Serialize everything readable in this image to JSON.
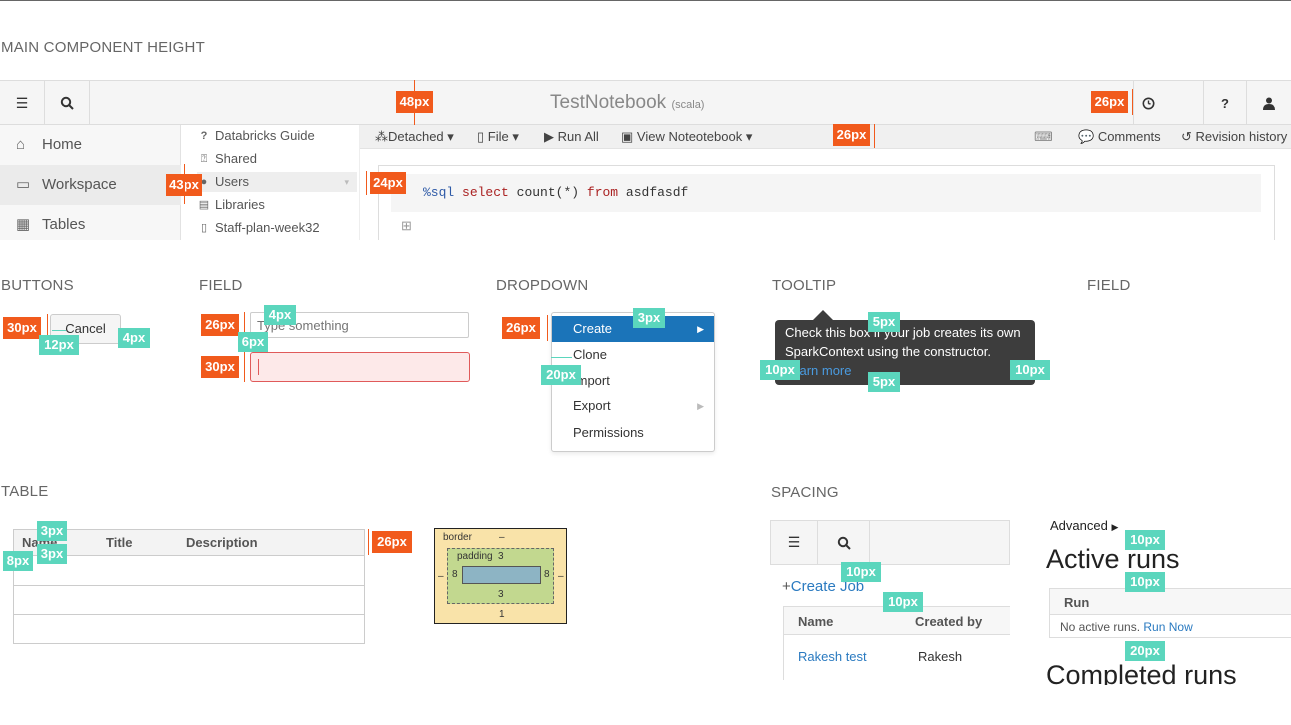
{
  "sections": {
    "main": "MAIN COMPONENT HEIGHT",
    "buttons": "BUTTONS",
    "field": "FIELD",
    "dropdown": "DROPDOWN",
    "tooltip": "TOOLTIP",
    "field2": "FIELD",
    "table": "TABLE",
    "spacing": "SPACING"
  },
  "notebook": {
    "title": "TestNotebook",
    "lang": "(scala)",
    "help": "?",
    "sidebar": [
      {
        "icon": "home-icon",
        "glyph": "⌂",
        "label": "Home"
      },
      {
        "icon": "folder-icon",
        "glyph": "▭",
        "label": "Workspace"
      },
      {
        "icon": "table-icon",
        "glyph": "▦",
        "label": "Tables"
      }
    ],
    "folder": [
      {
        "icon": "question-icon",
        "glyph": "?",
        "label": "Databricks Guide"
      },
      {
        "icon": "shared-icon",
        "glyph": "⍰",
        "label": "Shared"
      },
      {
        "icon": "user-icon",
        "glyph": "●",
        "label": "Users"
      },
      {
        "icon": "library-icon",
        "glyph": "▤",
        "label": "Libraries"
      },
      {
        "icon": "file-icon",
        "glyph": "▯",
        "label": "Staff-plan-week32"
      }
    ],
    "toolbar": {
      "detached": "Detached",
      "file": "File",
      "runall": "Run All",
      "view": "View Noteotebook",
      "comments": "Comments",
      "revision": "Revision history"
    },
    "code_kw1": "%sql",
    "code_kw2": "select",
    "code_mid": "count(*)",
    "code_kw3": "from",
    "code_end": "asdfasdf",
    "add_cell": "⊞"
  },
  "buttons": {
    "cancel": "Cancel"
  },
  "field": {
    "placeholder": "Type something"
  },
  "dropdown": {
    "items": [
      "Create",
      "Clone",
      "Import",
      "Export",
      "Permissions"
    ]
  },
  "tooltip": {
    "line1": "Check this box if your job creates its own",
    "line2": "SparkContext using the constructor.",
    "link": "Learn more"
  },
  "table": {
    "headers": [
      "Name",
      "Title",
      "Description"
    ]
  },
  "boxmodel": {
    "border": "border",
    "border_dash": "–",
    "padding": "padding",
    "padding_top": "3",
    "left_border": "–",
    "left_pad": "8",
    "right_pad": "8",
    "right_border": "–",
    "padding_bottom": "3",
    "border_bottom": "1"
  },
  "spacing": {
    "create_job": "Create Job",
    "col_name": "Name",
    "col_created": "Created by",
    "row_name": "Rakesh test",
    "row_created": "Rakesh"
  },
  "runs": {
    "advanced": "Advanced",
    "active": "Active runs",
    "run_col": "Run",
    "no_active": "No active runs.",
    "run_now": "Run Now",
    "completed": "Completed runs"
  },
  "measures": {
    "m48": "48px",
    "m26a": "26px",
    "m26b": "26px",
    "m43": "43px",
    "m24": "24px",
    "m30a": "30px",
    "m12": "12px",
    "m4a": "4px",
    "m26c": "26px",
    "m4b": "4px",
    "m6": "6px",
    "m30b": "30px",
    "m26d": "26px",
    "m3a": "3px",
    "m20a": "20px",
    "m5a": "5px",
    "m10a": "10px",
    "m10b": "10px",
    "m5b": "5px",
    "m3b": "3px",
    "m3c": "3px",
    "m8": "8px",
    "m26e": "26px",
    "m10c": "10px",
    "m10d": "10px",
    "m10e": "10px",
    "m10f": "10px",
    "m20b": "20px"
  }
}
